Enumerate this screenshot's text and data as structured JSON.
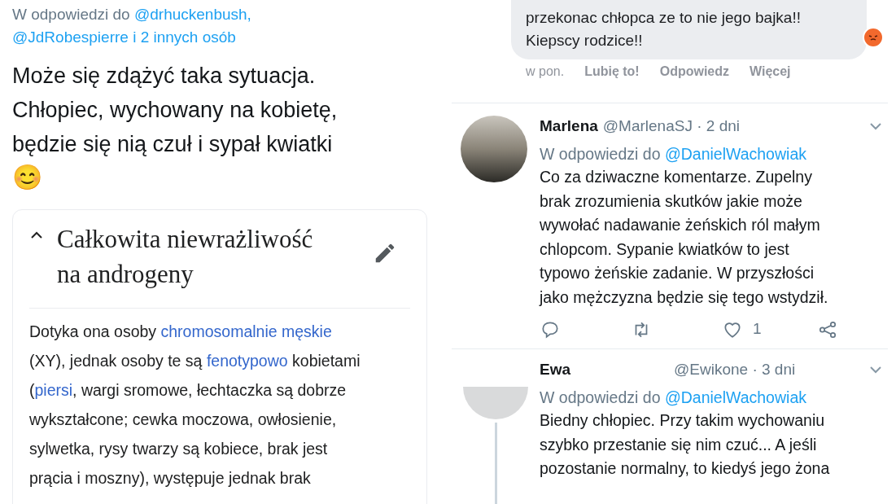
{
  "left_tweet": {
    "reply_to": [
      [
        {
          "text": "W odpowiedzi do ",
          "kind": "plain"
        },
        {
          "text": "@drhuckenbush,",
          "kind": "link"
        }
      ],
      [
        {
          "text": "@JdRobespierre i 2 innych osób",
          "kind": "link"
        }
      ]
    ],
    "text": "Może się zdążyć taka sytuacja.\nChłopiec, wychowany na kobietę,\nbędzie się nią czuł i sypał kwiatki",
    "emoji": "😊"
  },
  "wiki_card": {
    "expanded": true,
    "title": "Całkowita niewrażliwość\nna androgeny",
    "paragraph": [
      {
        "text": "Dotyka ona osoby ",
        "kind": "plain"
      },
      {
        "text": "chromosomalnie męskie",
        "kind": "link"
      },
      {
        "text": "\n(XY), jednak osoby te są ",
        "kind": "plain"
      },
      {
        "text": "fenotypowo",
        "kind": "link"
      },
      {
        "text": " kobietami\n(",
        "kind": "plain"
      },
      {
        "text": "piersi",
        "kind": "link"
      },
      {
        "text": ", wargi sromowe, łechtaczka są dobrze\nwykształcone; cewka moczowa, owłosienie,\nsylwetka, rysy twarzy są kobiece, brak jest\nprącia i moszny), występuje jednak brak",
        "kind": "plain"
      }
    ]
  },
  "fb_comment": {
    "text": "przekonac chłopca ze to nie jego bajka!!\nKiepscy rodzice!!",
    "time": "w pon.",
    "actions": [
      "Lubię to!",
      "Odpowiedz",
      "Więcej"
    ]
  },
  "tweets": [
    {
      "name": "Marlena",
      "handle": "@MarlenaSJ · 2 dni",
      "reply_to": "W odpowiedzi do ",
      "reply_handle": "@DanielWachowiak",
      "text": "Co za dziwaczne komentarze. Zupelny\nbrak zrozumienia skutków jakie może\nwywołać nadawanie żeńskich ról małym\nchlopcom. Sypanie kwiatków to jest\ntypowo żeńskie zadanie. W przyszłości\njako mężczyzna będzie się tego wstydził.",
      "likes": "1"
    },
    {
      "name": "Ewa",
      "handle": "@Ewikone · 3 dni",
      "reply_to": "W odpowiedzi do ",
      "reply_handle": "@DanielWachowiak",
      "text": "Biedny chłopiec. Przy takim wychowaniu\nszybko przestanie się nim czuć... A jeśli\npozostanie normalny, to kiedyś jego żona"
    }
  ]
}
